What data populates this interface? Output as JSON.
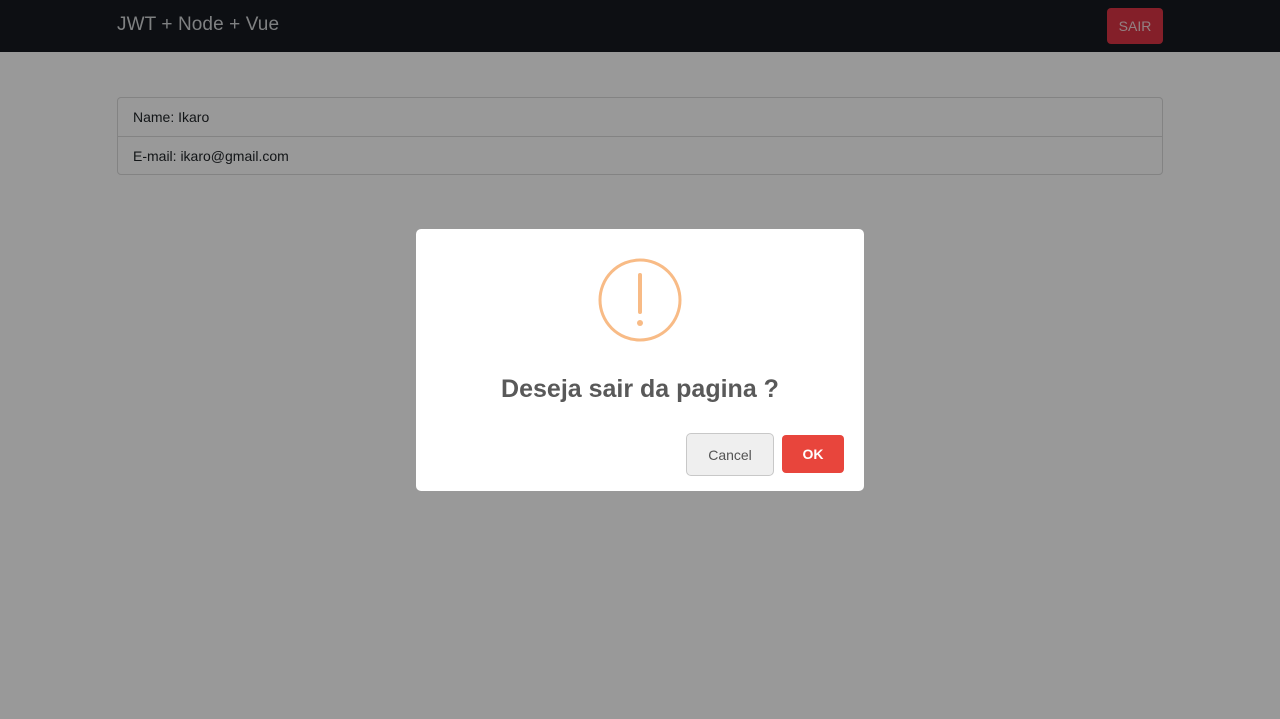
{
  "navbar": {
    "brand": "JWT + Node + Vue",
    "logout_label": "SAIR"
  },
  "profile": {
    "name_line": "Name: Ikaro",
    "email_line": "E-mail: ikaro@gmail.com"
  },
  "dialog": {
    "icon": "warning-exclamation-icon",
    "title": "Deseja sair da pagina ?",
    "cancel_label": "Cancel",
    "ok_label": "OK"
  },
  "colors": {
    "navbar_bg": "#171a21",
    "danger": "#dc3545",
    "warning_icon": "#f8bb86",
    "confirm": "#e8453c"
  }
}
